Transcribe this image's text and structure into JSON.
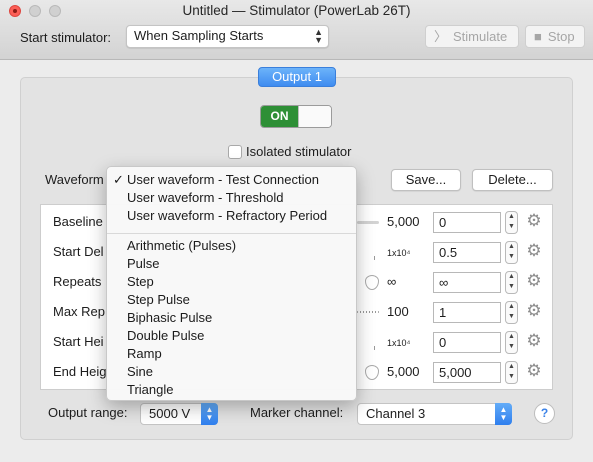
{
  "window": {
    "title": "Untitled — Stimulator (PowerLab 26T)"
  },
  "toolbar": {
    "start_label": "Start stimulator:",
    "start_value": "When Sampling Starts",
    "stimulate_label": "Stimulate",
    "stop_label": "Stop"
  },
  "output": {
    "tab_label": "Output 1",
    "toggle_label": "ON",
    "isolated_label": "Isolated stimulator",
    "waveform_label": "Waveform",
    "save_label": "Save...",
    "delete_label": "Delete..."
  },
  "params": [
    {
      "name": "Baseline",
      "max": "5,000",
      "value": "0"
    },
    {
      "name": "Start Del",
      "max": "1x10⁴",
      "value": "0.5"
    },
    {
      "name": "Repeats",
      "max": "∞",
      "value": "∞"
    },
    {
      "name": "Max Rep",
      "max": "100",
      "value": "1"
    },
    {
      "name": "Start Hei",
      "max": "1x10⁴",
      "value": "0"
    },
    {
      "name": "End Heig",
      "max": "5,000",
      "value": "5,000"
    }
  ],
  "bottom": {
    "output_range_label": "Output range:",
    "output_range_value": "5000 V",
    "marker_label": "Marker channel:",
    "marker_value": "Channel 3",
    "help_label": "?"
  },
  "waveform_menu": {
    "selected": "User waveform - Test Connection",
    "user_items": [
      "User waveform - Test Connection",
      "User waveform - Threshold",
      "User waveform - Refractory Period"
    ],
    "builtin_items": [
      "Arithmetic (Pulses)",
      "Pulse",
      "Step",
      "Step Pulse",
      "Biphasic Pulse",
      "Double Pulse",
      "Ramp",
      "Sine",
      "Triangle"
    ]
  },
  "colors": {
    "accent": "#3f8cf0",
    "toggle_on": "#2e8f36",
    "close": "#fc5f57"
  }
}
